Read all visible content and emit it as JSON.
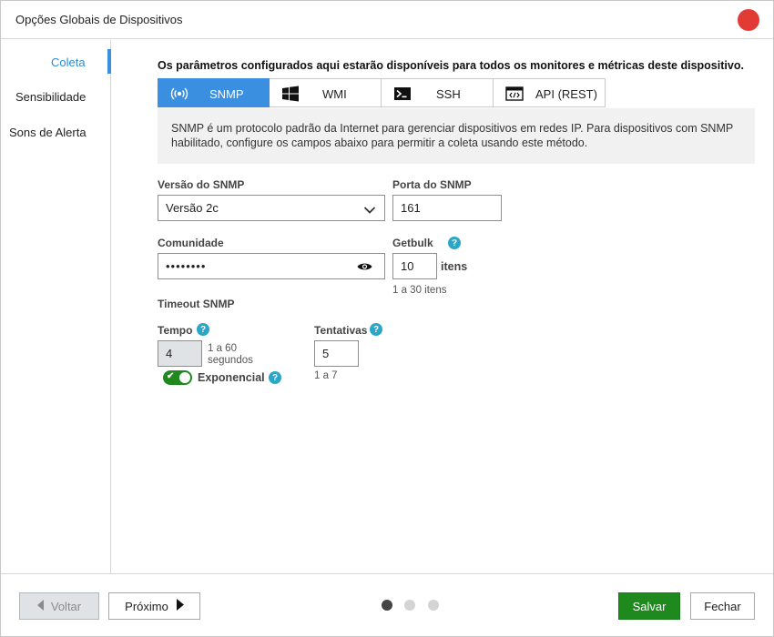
{
  "window": {
    "title": "Opções Globais de Dispositivos",
    "close_color": "#e23b36"
  },
  "sidebar": {
    "items": [
      {
        "label": "Coleta",
        "active": true
      },
      {
        "label": "Sensibilidade",
        "active": false
      },
      {
        "label": "Sons de Alerta",
        "active": false
      }
    ]
  },
  "main": {
    "intro": "Os parâmetros configurados aqui estarão disponíveis para todos os monitores e métricas deste dispositivo.",
    "tabs": [
      {
        "label": "SNMP",
        "icon": "signal-icon",
        "active": true
      },
      {
        "label": "WMI",
        "icon": "windows-icon",
        "active": false
      },
      {
        "label": "SSH",
        "icon": "terminal-icon",
        "active": false
      },
      {
        "label": "API (REST)",
        "icon": "code-window-icon",
        "active": false
      }
    ],
    "info": "SNMP é um protocolo padrão da Internet para gerenciar dispositivos em redes IP. Para dispositivos com SNMP habilitado, configure os campos abaixo para permitir a coleta usando este método."
  },
  "form": {
    "version": {
      "label": "Versão do SNMP",
      "value": "Versão 2c"
    },
    "port": {
      "label": "Porta do SNMP",
      "value": "161"
    },
    "community": {
      "label": "Comunidade",
      "value": "••••••••"
    },
    "getbulk": {
      "label": "Getbulk",
      "value": "10",
      "unit": "itens",
      "hint": "1 a 30 itens"
    },
    "timeout": {
      "label": "Timeout SNMP",
      "tempo": {
        "label": "Tempo",
        "value": "4",
        "hint_line1": "1 a 60",
        "hint_line2": "segundos"
      },
      "tentativas": {
        "label": "Tentativas",
        "value": "5",
        "hint": "1 a 7"
      },
      "exponencial": {
        "label": "Exponencial",
        "enabled": true
      }
    }
  },
  "footer": {
    "back_label": "Voltar",
    "next_label": "Próximo",
    "save_label": "Salvar",
    "close_label": "Fechar",
    "pages": {
      "current": 1,
      "total": 3
    }
  },
  "colors": {
    "accent": "#3a8fe0",
    "primary": "#1e8a1e",
    "help": "#2aa6c7"
  }
}
